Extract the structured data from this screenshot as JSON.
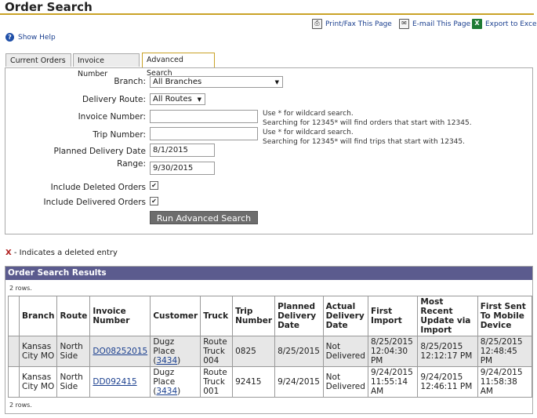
{
  "page": {
    "title": "Order Search"
  },
  "toolbar": {
    "print": "Print/Fax This Page",
    "email": "E-mail This Page",
    "excel": "Export to Excel"
  },
  "help": {
    "label": "Show Help"
  },
  "tabs": [
    {
      "label": "Current Orders"
    },
    {
      "label": "Invoice Number"
    },
    {
      "label": "Advanced Search"
    }
  ],
  "form": {
    "branch_label": "Branch:",
    "branch_value": "All Branches",
    "route_label": "Delivery Route:",
    "route_value": "All Routes",
    "invoice_label": "Invoice Number:",
    "invoice_value": "",
    "invoice_hint1": "Use * for wildcard search.",
    "invoice_hint2": "Searching for 12345* will find orders that start with 12345.",
    "trip_label": "Trip Number:",
    "trip_value": "",
    "trip_hint1": "Use * for wildcard search.",
    "trip_hint2": "Searching for 12345* will find trips that start with 12345.",
    "planned_label1": "Planned Delivery Date",
    "planned_label2": "Range:",
    "date_from": "8/1/2015",
    "date_to": "9/30/2015",
    "include_deleted_label": "Include Deleted Orders",
    "include_deleted_checked": true,
    "include_delivered_label": "Include Delivered Orders",
    "include_delivered_checked": true,
    "run_button": "Run Advanced Search"
  },
  "legend": {
    "x": "X",
    "text": " - Indicates a deleted entry"
  },
  "results": {
    "title": "Order Search Results",
    "rows_top": "2 rows.",
    "rows_bottom": "2 rows.",
    "columns": [
      "Branch",
      "Route",
      "Invoice Number",
      "Customer",
      "Truck",
      "Trip Number",
      "Planned Delivery Date",
      "Actual Delivery Date",
      "First Import",
      "Most Recent Update via Import",
      "First Sent To Mobile Device"
    ],
    "rows": [
      {
        "branch": "Kansas City MO",
        "route": "North Side",
        "invoice": "DO08252015",
        "customer_name": "Dugz Place",
        "customer_open": "(",
        "customer_id": "3434",
        "customer_close": ")",
        "truck": "Route Truck 004",
        "trip": "0825",
        "planned": "8/25/2015",
        "actual": "Not Delivered",
        "first_import": "8/25/2015 12:04:30 PM",
        "recent_update": "8/25/2015 12:12:17 PM",
        "first_sent": "8/25/2015 12:48:45 PM"
      },
      {
        "branch": "Kansas City MO",
        "route": "North Side",
        "invoice": "DD092415",
        "customer_name": "Dugz Place",
        "customer_open": "(",
        "customer_id": "3434",
        "customer_close": ")",
        "truck": "Route Truck 001",
        "trip": "92415",
        "planned": "9/24/2015",
        "actual": "Not Delivered",
        "first_import": "9/24/2015 11:55:14 AM",
        "recent_update": "9/24/2015 12:46:11 PM",
        "first_sent": "9/24/2015 11:58:38 AM"
      }
    ]
  }
}
